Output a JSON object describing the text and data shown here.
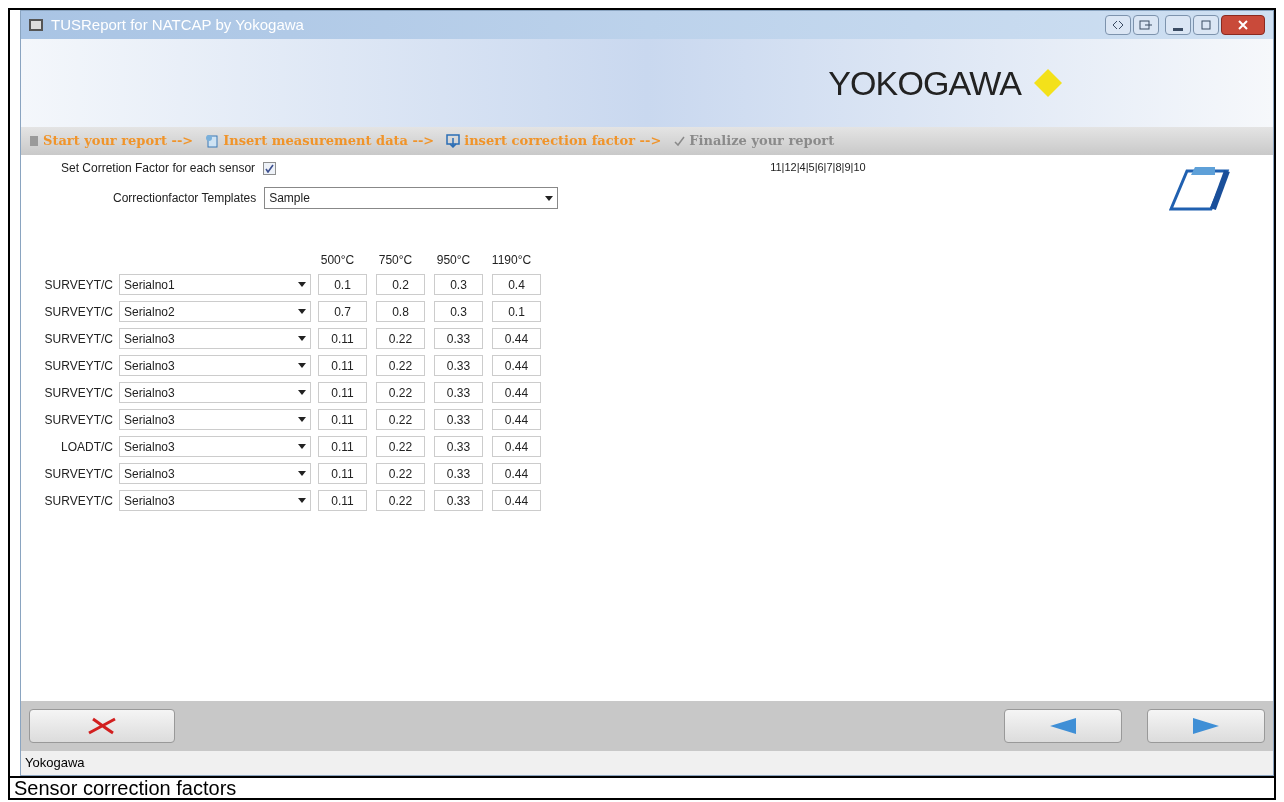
{
  "window": {
    "title": "TUSReport for NATCAP by Yokogawa"
  },
  "banner": {
    "logo": "YOKOGAWA"
  },
  "steps": [
    {
      "label": "Start your report -->",
      "active": true
    },
    {
      "label": "Insert measurement data -->",
      "active": true
    },
    {
      "label": "insert correction factor -->",
      "active": true
    },
    {
      "label": "Finalize your report",
      "active": false
    }
  ],
  "settings": {
    "checkbox_label": "Set Corretion Factor for each sensor",
    "checked": true,
    "template_label": "Correctionfactor Templates",
    "template_value": "Sample"
  },
  "page_links": "11|12|4|5|6|7|8|9|10",
  "table": {
    "columns": [
      "500°C",
      "750°C",
      "950°C",
      "1190°C"
    ],
    "rows": [
      {
        "label": "SURVEYT/C",
        "serial": "Serialno1",
        "values": [
          "0.1",
          "0.2",
          "0.3",
          "0.4"
        ]
      },
      {
        "label": "SURVEYT/C",
        "serial": "Serialno2",
        "values": [
          "0.7",
          "0.8",
          "0.3",
          "0.1"
        ]
      },
      {
        "label": "SURVEYT/C",
        "serial": "Serialno3",
        "values": [
          "0.11",
          "0.22",
          "0.33",
          "0.44"
        ]
      },
      {
        "label": "SURVEYT/C",
        "serial": "Serialno3",
        "values": [
          "0.11",
          "0.22",
          "0.33",
          "0.44"
        ]
      },
      {
        "label": "SURVEYT/C",
        "serial": "Serialno3",
        "values": [
          "0.11",
          "0.22",
          "0.33",
          "0.44"
        ]
      },
      {
        "label": "SURVEYT/C",
        "serial": "Serialno3",
        "values": [
          "0.11",
          "0.22",
          "0.33",
          "0.44"
        ]
      },
      {
        "label": "LOADT/C",
        "serial": "Serialno3",
        "values": [
          "0.11",
          "0.22",
          "0.33",
          "0.44"
        ]
      },
      {
        "label": "SURVEYT/C",
        "serial": "Serialno3",
        "values": [
          "0.11",
          "0.22",
          "0.33",
          "0.44"
        ]
      },
      {
        "label": "SURVEYT/C",
        "serial": "Serialno3",
        "values": [
          "0.11",
          "0.22",
          "0.33",
          "0.44"
        ]
      }
    ]
  },
  "status_bar": "Yokogawa",
  "caption": "Sensor correction factors"
}
